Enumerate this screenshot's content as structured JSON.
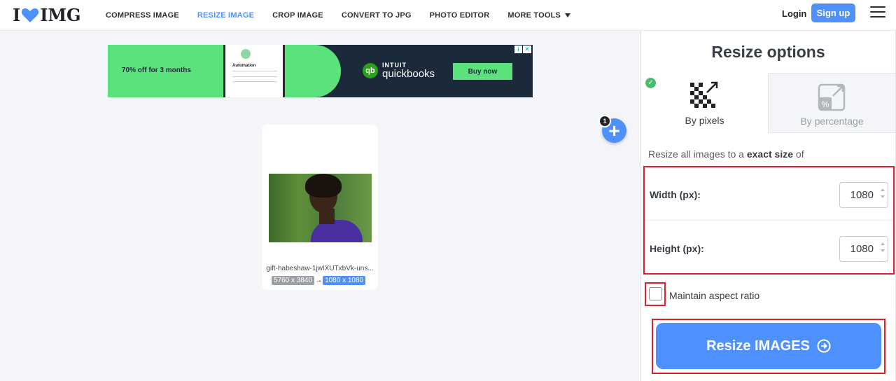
{
  "header": {
    "logo_left": "I",
    "logo_right": "IMG",
    "logo_icon": "heart-icon",
    "nav": [
      {
        "label": "COMPRESS IMAGE",
        "active": false
      },
      {
        "label": "RESIZE IMAGE",
        "active": true
      },
      {
        "label": "CROP IMAGE",
        "active": false
      },
      {
        "label": "CONVERT TO JPG",
        "active": false
      },
      {
        "label": "PHOTO EDITOR",
        "active": false
      },
      {
        "label": "MORE TOOLS",
        "active": false
      }
    ],
    "login": "Login",
    "signup": "Sign up",
    "menu_icon": "hamburger-icon"
  },
  "ad": {
    "offer": "70% off for 3 months",
    "phone_title": "Automation",
    "brand_top": "INTUIT",
    "brand_bottom": "quickbooks",
    "cta": "Buy now",
    "info": "i",
    "close": "✕"
  },
  "file": {
    "name": "gift-habeshaw-1jwIXUTxbVk-uns...",
    "original_size": "5760 x 3840",
    "arrow": "→",
    "new_size": "1080 x 1080",
    "count": "1",
    "add": "+"
  },
  "sidebar": {
    "title": "Resize options",
    "tabs": [
      {
        "label": "By pixels",
        "selected": true,
        "icon": "pixels-icon"
      },
      {
        "label": "By percentage",
        "selected": false,
        "icon": "percentage-icon"
      }
    ],
    "desc_prefix": "Resize all images to a ",
    "desc_bold": "exact size",
    "desc_suffix": " of",
    "width_label": "Width (px):",
    "width_value": "1080",
    "height_label": "Height (px):",
    "height_value": "1080",
    "aspect_label": "Maintain aspect ratio",
    "aspect_checked": false,
    "submit": "Resize IMAGES"
  },
  "colors": {
    "accent": "#4d90fe",
    "highlight": "#e0202a",
    "ad_green": "#5ce27d",
    "check_green": "#4cbb6c"
  }
}
